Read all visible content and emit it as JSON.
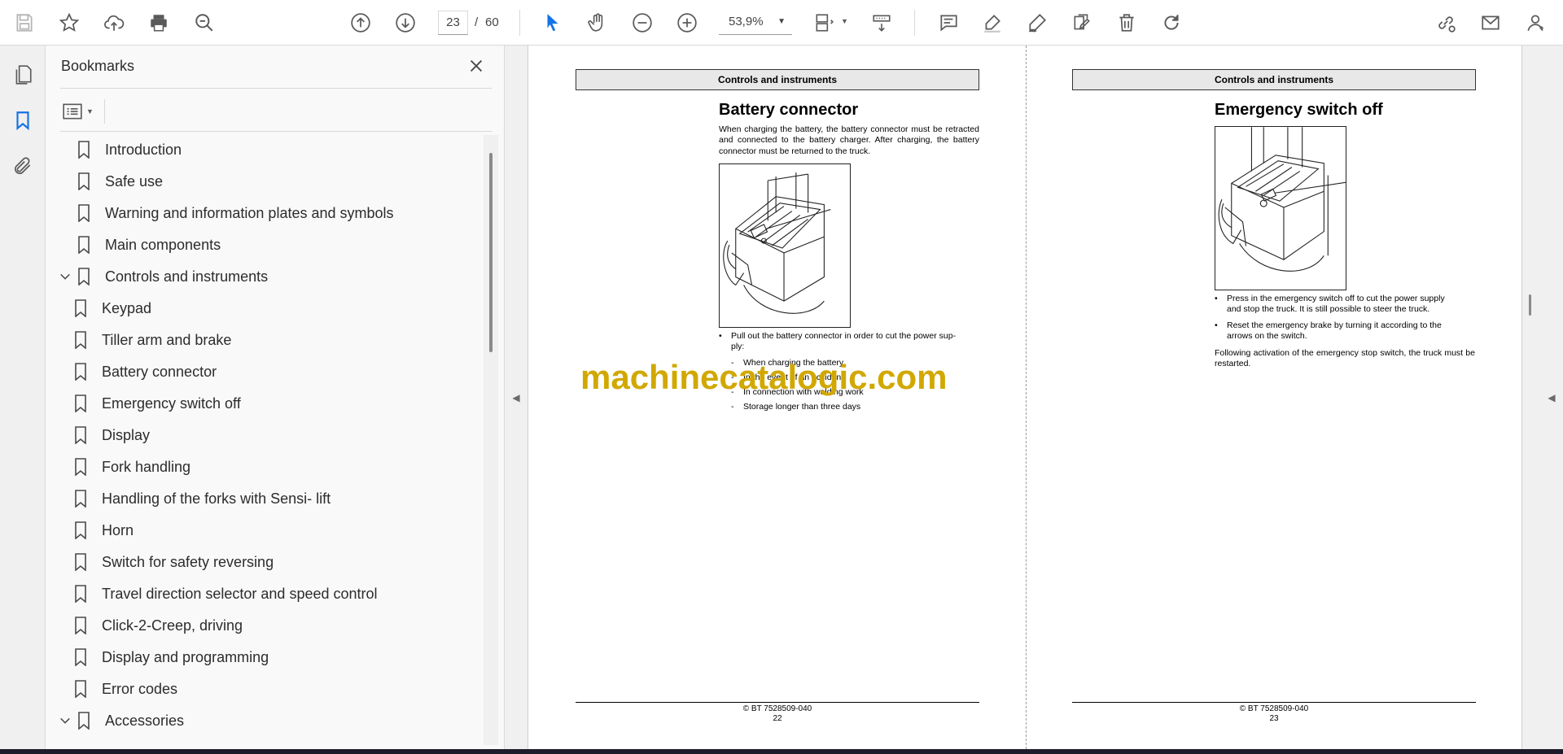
{
  "toolbar": {
    "current_page": "23",
    "page_separator": "/",
    "total_pages": "60",
    "zoom": "53,9%"
  },
  "bookmarks_panel": {
    "title": "Bookmarks",
    "items": [
      {
        "label": "Introduction",
        "level": 0,
        "expanded": null
      },
      {
        "label": "Safe use",
        "level": 0,
        "expanded": null
      },
      {
        "label": "Warning and information plates and symbols",
        "level": 0,
        "expanded": null
      },
      {
        "label": "Main components",
        "level": 0,
        "expanded": null
      },
      {
        "label": "Controls and instruments",
        "level": 0,
        "expanded": true
      },
      {
        "label": "Keypad",
        "level": 1,
        "expanded": null
      },
      {
        "label": "Tiller arm and brake",
        "level": 1,
        "expanded": null
      },
      {
        "label": "Battery connector",
        "level": 1,
        "expanded": null
      },
      {
        "label": "Emergency switch off",
        "level": 1,
        "expanded": null
      },
      {
        "label": "Display",
        "level": 1,
        "expanded": null
      },
      {
        "label": "Fork handling",
        "level": 1,
        "expanded": null
      },
      {
        "label": "Handling of the forks with Sensi- lift",
        "level": 1,
        "expanded": null
      },
      {
        "label": "Horn",
        "level": 1,
        "expanded": null
      },
      {
        "label": "Switch for safety reversing",
        "level": 1,
        "expanded": null
      },
      {
        "label": "Travel direction selector and speed control",
        "level": 1,
        "expanded": null
      },
      {
        "label": "Click-2-Creep, driving",
        "level": 1,
        "expanded": null
      },
      {
        "label": "Display and programming",
        "level": 1,
        "expanded": null
      },
      {
        "label": "Error codes",
        "level": 1,
        "expanded": null
      },
      {
        "label": "Accessories",
        "level": 0,
        "expanded": true
      }
    ]
  },
  "left_page": {
    "header": "Controls and instruments",
    "title": "Battery connector",
    "intro": "When charging the battery, the battery connector must be retracted and connected to the battery charger. After charging, the battery connector must be returned to the truck.",
    "bullet_1_line1": "Pull out the battery connector in order to cut the power sup-",
    "bullet_1_line2": "ply:",
    "dashes": [
      "When charging the battery",
      "In the event of an accident",
      "In connection with welding work",
      "Storage longer than three days"
    ],
    "footer_doc": "© BT 7528509-040",
    "footer_page": "22"
  },
  "right_page": {
    "header": "Controls and instruments",
    "title": "Emergency switch off",
    "bullet_1_line1": "Press in the emergency switch off to cut the power supply",
    "bullet_1_line2": "and stop the truck. It is still possible to steer the truck.",
    "bullet_2_line1": "Reset the emergency brake by turning it according to the",
    "bullet_2_line2": "arrows on the switch.",
    "note": "Following activation of the emergency stop switch, the truck must be restarted.",
    "footer_doc": "© BT 7528509-040",
    "footer_page": "23"
  },
  "watermark": "machinecatalogic.com",
  "colors": {
    "watermark": "#d1a800",
    "select_tool": "#1473e6"
  }
}
